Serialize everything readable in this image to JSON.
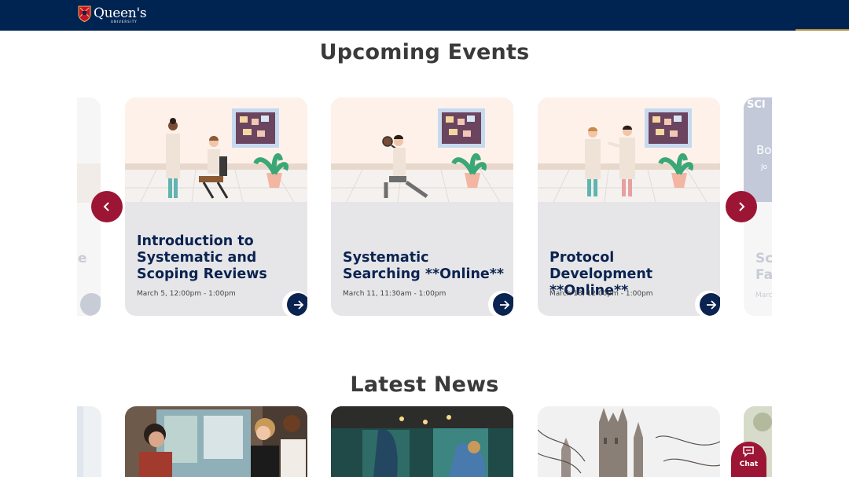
{
  "header": {
    "logo_text": "Queen's",
    "logo_subtext": "UNIVERSITY"
  },
  "events": {
    "title": "Upcoming Events",
    "prev_label": "‹",
    "next_label": "›",
    "ghost_left_text": "e",
    "ghost_right_title": "Sci Fa",
    "ghost_right_banner": "Bo",
    "ghost_right_sub": "Jo",
    "ghost_right_date": "Marc",
    "cards": [
      {
        "title": "Introduction to Systematic and Scoping Reviews",
        "date": "March 5, 12:00pm - 1:00pm"
      },
      {
        "title": "Systematic Searching **Online**",
        "date": "March 11, 11:30am - 1:00pm"
      },
      {
        "title": "Protocol Development **Online**",
        "date": "March 18, 12:00pm - 1:00pm"
      }
    ]
  },
  "news": {
    "title": "Latest News"
  },
  "chat": {
    "label": "Chat"
  },
  "colors": {
    "navy": "#002452",
    "accent_red": "#9d1535",
    "card_bg": "#e6e6e9",
    "title_blue": "#0b2350"
  }
}
